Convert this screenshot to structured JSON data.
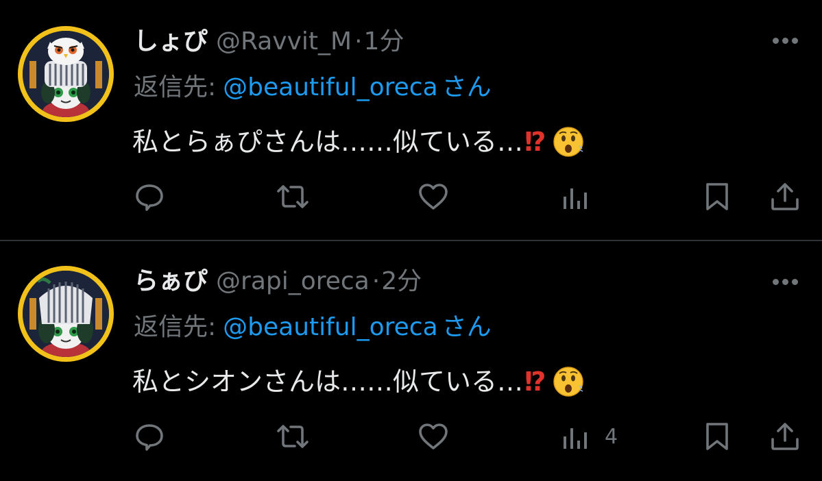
{
  "tweets": [
    {
      "display_name": "しょぴ",
      "handle": "@Ravvit_M",
      "separator": "·",
      "time": "1分",
      "reply_prefix": "返信先:",
      "reply_mention": "@beautiful_oreca",
      "reply_suffix": "さん",
      "text": "私とらぁぴさんは……似ている…",
      "emoji_exclaim": "⁉",
      "emoji_face": "hushed-face",
      "avatar": "owl-knight-avatar",
      "views_count": ""
    },
    {
      "display_name": "らぁぴ",
      "handle": "@rapi_oreca",
      "separator": "·",
      "time": "2分",
      "reply_prefix": "返信先:",
      "reply_mention": "@beautiful_oreca",
      "reply_suffix": "さん",
      "text": "私とシオンさんは……似ている…",
      "emoji_exclaim": "⁉",
      "emoji_face": "hushed-face",
      "avatar": "knight-avatar",
      "views_count": "4"
    }
  ],
  "icons": {
    "reply": "reply-icon",
    "retweet": "retweet-icon",
    "like": "heart-icon",
    "views": "views-icon",
    "bookmark": "bookmark-icon",
    "share": "share-icon",
    "more": "more-icon"
  },
  "colors": {
    "background": "#000000",
    "primary_text": "#e7e9ea",
    "secondary_text": "#71767b",
    "link": "#1d9bf0",
    "divider": "#2f3336",
    "avatar_ring": "#f2c21b",
    "exclaim": "#e0332b"
  }
}
